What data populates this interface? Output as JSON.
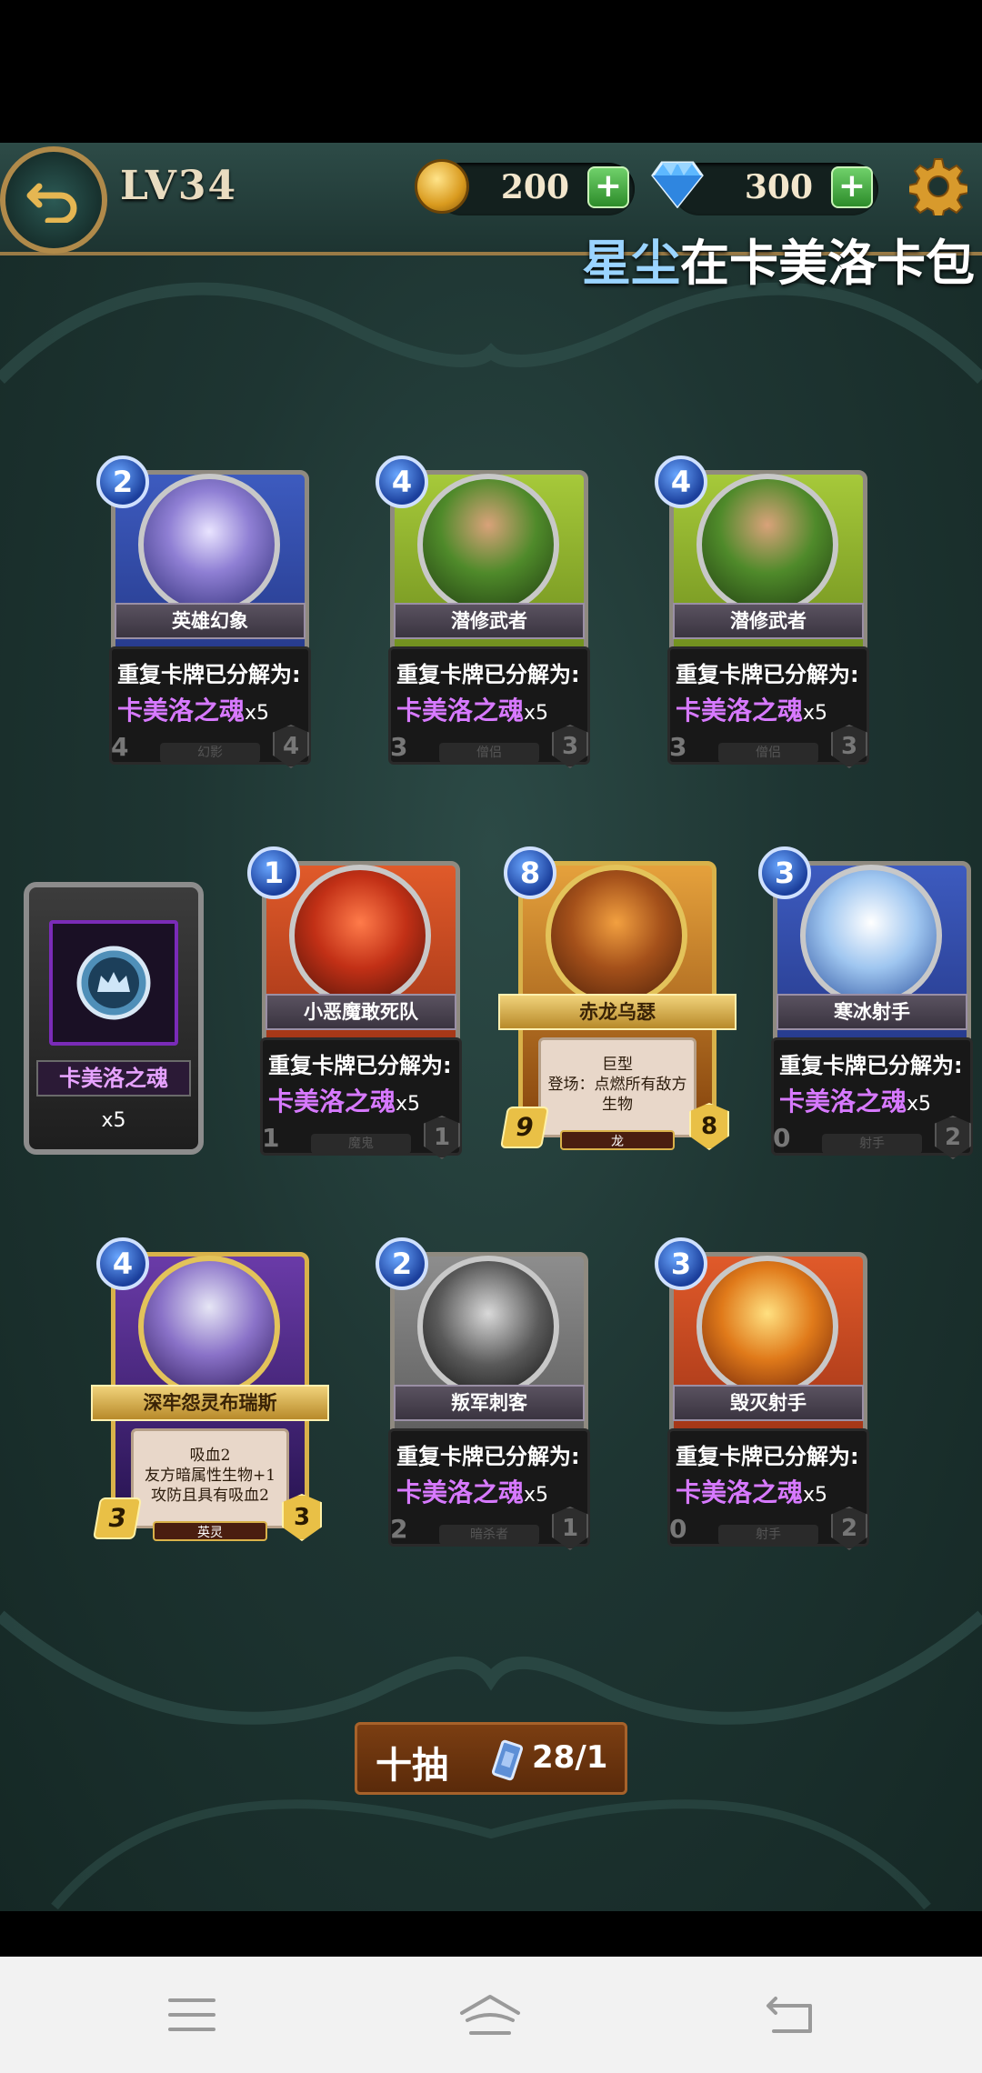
{
  "header": {
    "level": "LV34",
    "gold": "200",
    "gems": "300",
    "ticker_highlight": "星尘",
    "ticker_text": "在卡美洛卡包"
  },
  "colors": {
    "duplicate_reward": "#d779ff",
    "panel_bg": "#1e3532",
    "gold_trim": "#b08a4a"
  },
  "cards": [
    {
      "name": "英雄幻象",
      "cost": "2",
      "frame": "blue",
      "dup_title": "重复卡牌已分解为:",
      "reward": "卡美洛之魂",
      "reward_count": "x5",
      "attack": "4",
      "health": "4",
      "type": "幻影",
      "legend": false
    },
    {
      "name": "潜修武者",
      "cost": "4",
      "frame": "green",
      "dup_title": "重复卡牌已分解为:",
      "reward": "卡美洛之魂",
      "reward_count": "x5",
      "attack": "3",
      "health": "3",
      "type": "僧侣",
      "legend": false
    },
    {
      "name": "潜修武者",
      "cost": "4",
      "frame": "green",
      "dup_title": "重复卡牌已分解为:",
      "reward": "卡美洛之魂",
      "reward_count": "x5",
      "attack": "3",
      "health": "3",
      "type": "僧侣",
      "legend": false
    },
    {
      "name": "小恶魔敢死队",
      "cost": "1",
      "frame": "red",
      "dup_title": "重复卡牌已分解为:",
      "reward": "卡美洛之魂",
      "reward_count": "x5",
      "attack": "1",
      "health": "1",
      "type": "魔鬼",
      "legend": false
    },
    {
      "name": "赤龙乌瑟",
      "cost": "8",
      "frame": "gold",
      "ability_lines": [
        "巨型",
        "登场：点燃所有敌方",
        "生物"
      ],
      "attack": "9",
      "health": "8",
      "type": "龙",
      "legend": true
    },
    {
      "name": "寒冰射手",
      "cost": "3",
      "frame": "blue",
      "dup_title": "重复卡牌已分解为:",
      "reward": "卡美洛之魂",
      "reward_count": "x5",
      "attack": "0",
      "health": "2",
      "type": "射手",
      "legend": false
    },
    {
      "name": "深牢怨灵布瑞斯",
      "cost": "4",
      "frame": "purple",
      "ability_lines": [
        "吸血2",
        "友方暗属性生物+1",
        "攻防且具有吸血2"
      ],
      "attack": "3",
      "health": "3",
      "type": "英灵",
      "legend": true
    },
    {
      "name": "叛军刺客",
      "cost": "2",
      "frame": "gray",
      "dup_title": "重复卡牌已分解为:",
      "reward": "卡美洛之魂",
      "reward_count": "x5",
      "attack": "2",
      "health": "1",
      "type": "暗杀者",
      "legend": false
    },
    {
      "name": "毁灭射手",
      "cost": "3",
      "frame": "red",
      "dup_title": "重复卡牌已分解为:",
      "reward": "卡美洛之魂",
      "reward_count": "x5",
      "attack": "0",
      "health": "2",
      "type": "射手",
      "legend": false
    }
  ],
  "soul_item": {
    "name": "卡美洛之魂",
    "count": "x5"
  },
  "draw_button": {
    "label": "十抽",
    "ticket_count": "28/1"
  },
  "navbar": {
    "menu_icon": "menu-icon",
    "home_icon": "home-icon",
    "back_icon": "back-icon"
  }
}
